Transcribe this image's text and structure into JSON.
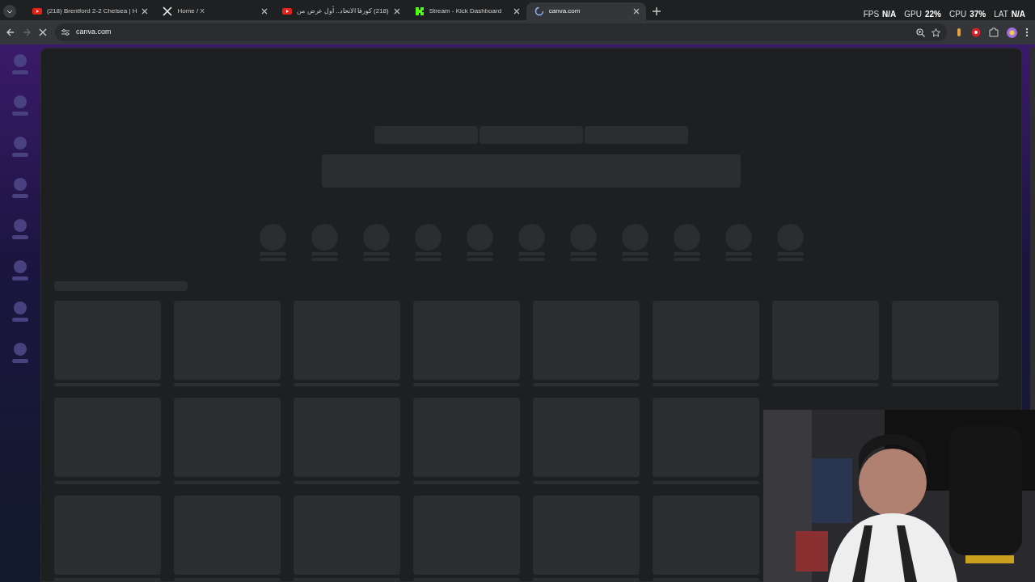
{
  "tabs": [
    {
      "title": "(218) Brentford 2-2 Chelsea | H",
      "kind": "youtube",
      "selected": false
    },
    {
      "title": "Home / X",
      "kind": "x",
      "selected": false
    },
    {
      "title": "(218) كورفا الاتحاد.. أول عرض من",
      "kind": "youtube",
      "selected": false
    },
    {
      "title": "Stream - Kick Dashboard",
      "kind": "kick",
      "selected": false
    },
    {
      "title": "canva.com",
      "kind": "loading",
      "selected": true
    }
  ],
  "address": {
    "url": "canva.com",
    "loading": true
  },
  "stats": [
    {
      "label": "FPS",
      "value": "N/A"
    },
    {
      "label": "GPU",
      "value": "22%"
    },
    {
      "label": "CPU",
      "value": "37%"
    },
    {
      "label": "LAT",
      "value": "N/A"
    }
  ]
}
